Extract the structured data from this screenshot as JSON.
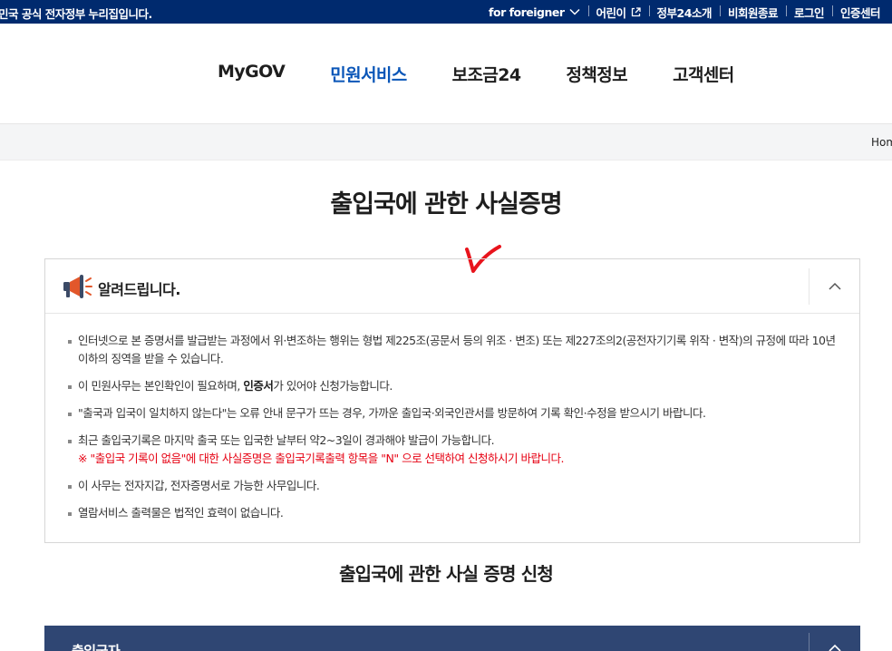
{
  "topbar": {
    "slogan": "민국 공식 전자정부 누리집입니다.",
    "links": [
      {
        "label": "for foreigner"
      },
      {
        "label": "어린이"
      },
      {
        "label": "정부24소개"
      },
      {
        "label": "비회원종료"
      },
      {
        "label": "로그인"
      },
      {
        "label": "인증센터"
      }
    ]
  },
  "gnb": {
    "items": [
      "MyGOV",
      "민원서비스",
      "보조금24",
      "정책정보",
      "고객센터"
    ],
    "active_index": 1
  },
  "breadcrumb": {
    "home": "Hom"
  },
  "page": {
    "title": "출입국에 관한 사실증명",
    "subtitle": "출입국에 관한 사실 증명 신청"
  },
  "notice": {
    "title": "알려드립니다.",
    "items": [
      "인터넷으로 본 증명서를 발급받는 과정에서 위·변조하는 행위는 형법 제225조(공문서 등의 위조 · 변조) 또는 제227조의2(공전자기기록 위작 · 변작)의 규정에 따라 10년 이하의 징역을 받을 수 있습니다.",
      {
        "before": "이 민원사무는 본인확인이 필요하며, ",
        "bold": "인증서",
        "after": "가 있어야 신청가능합니다."
      },
      "\"출국과 입국이 일치하지 않는다\"는 오류 안내 문구가 뜨는 경우, 가까운 출입국·외국인관서를 방문하여 기록 확인·수정을 받으시기 바랍니다.",
      {
        "text": "최근 출입국기록은 마지막 출국 또는 입국한 날부터 약2~3일이 경과해야 발급이 가능합니다.",
        "red": "※ \"출입국 기록이 없음\"에 대한 사실증명은 출입국기록출력 항목을 \"N\" 으로 선택하여 신청하시기 바랍니다."
      },
      "이 사무는 전자지갑, 전자증명서로 가능한 사무입니다.",
      "열람서비스 출력물은 법적인 효력이 없습니다."
    ]
  },
  "applicant": {
    "label": "출입국자"
  },
  "colors": {
    "topbar": "#002a6e",
    "active_menu": "#0a56b8",
    "notice_red": "#e60012",
    "applicant_bar": "#2f4673",
    "annotation_mark": "#e8141c"
  }
}
